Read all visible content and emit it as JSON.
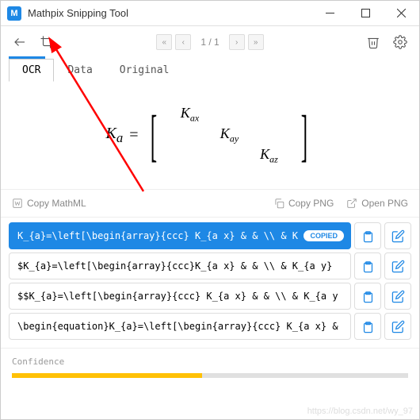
{
  "window": {
    "title": "Mathpix Snipping Tool"
  },
  "pager": {
    "info": "1 / 1"
  },
  "tabs": {
    "ocr": "OCR",
    "data": "Data",
    "original": "Original"
  },
  "preview": {
    "lhs": "K",
    "lhs_sub": "a",
    "eq": "=",
    "m00": "K",
    "m00s": "ax",
    "m11": "K",
    "m11s": "ay",
    "m22": "K",
    "m22s": "az"
  },
  "actions": {
    "copyMathML": "Copy MathML",
    "copyPNG": "Copy PNG",
    "openPNG": "Open PNG"
  },
  "results": [
    {
      "text": "K_{a}=\\left[\\begin{array}{ccc} K_{a x} & & \\\\ & K",
      "copied": true,
      "badge": "COPIED"
    },
    {
      "text": "$K_{a}=\\left[\\begin{array}{ccc}K_{a x} & & \\\\ & K_{a y}",
      "copied": false
    },
    {
      "text": "$$K_{a}=\\left[\\begin{array}{ccc} K_{a x} & & \\\\ & K_{a y",
      "copied": false
    },
    {
      "text": "\\begin{equation}K_{a}=\\left[\\begin{array}{ccc} K_{a x} &",
      "copied": false
    }
  ],
  "confidence": {
    "label": "Confidence"
  },
  "watermark": "https://blog.csdn.net/wy_97"
}
